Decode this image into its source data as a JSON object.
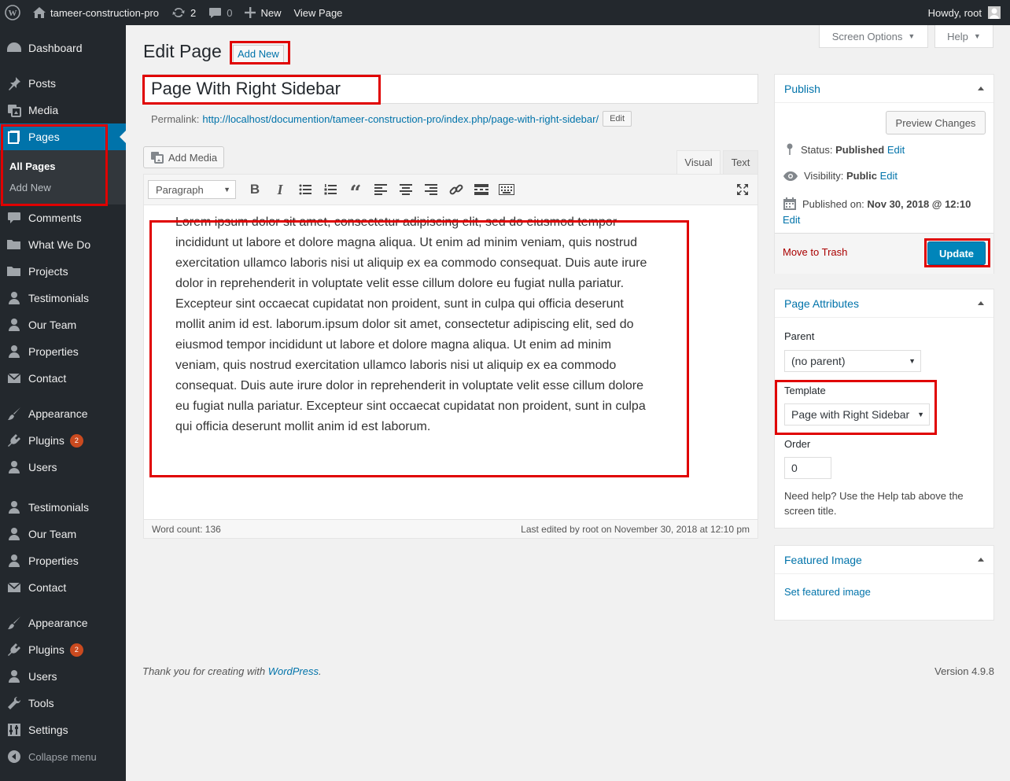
{
  "adminbar": {
    "site_name": "tameer-construction-pro",
    "updates_count": "2",
    "comments_count": "0",
    "new_label": "New",
    "view_page_label": "View Page",
    "howdy": "Howdy, root"
  },
  "sidebar": {
    "items": [
      {
        "label": "Dashboard"
      },
      {
        "label": "Posts"
      },
      {
        "label": "Media"
      },
      {
        "label": "Pages"
      },
      {
        "label": "Comments"
      },
      {
        "label": "What We Do"
      },
      {
        "label": "Projects"
      },
      {
        "label": "Testimonials"
      },
      {
        "label": "Our Team"
      },
      {
        "label": "Properties"
      },
      {
        "label": "Contact"
      },
      {
        "label": "Appearance"
      },
      {
        "label": "Plugins",
        "badge": "2"
      },
      {
        "label": "Users"
      },
      {
        "label": "Testimonials"
      },
      {
        "label": "Our Team"
      },
      {
        "label": "Properties"
      },
      {
        "label": "Contact"
      },
      {
        "label": "Appearance"
      },
      {
        "label": "Plugins",
        "badge": "2"
      },
      {
        "label": "Users"
      },
      {
        "label": "Tools"
      },
      {
        "label": "Settings"
      }
    ],
    "pages_submenu": [
      "All Pages",
      "Add New"
    ],
    "collapse_label": "Collapse menu"
  },
  "header": {
    "screen_options": "Screen Options",
    "help": "Help",
    "title": "Edit Page",
    "add_new": "Add New"
  },
  "post": {
    "title": "Page With Right Sidebar",
    "permalink_label": "Permalink:",
    "permalink_base": "http://localhost/documention/tameer-construction-pro/index.php/",
    "permalink_slug": "page-with-right-sidebar/",
    "edit_label": "Edit"
  },
  "editor": {
    "add_media": "Add Media",
    "tab_visual": "Visual",
    "tab_text": "Text",
    "format": "Paragraph",
    "content": "Lorem ipsum dolor sit amet, consectetur adipiscing elit, sed do eiusmod tempor incididunt ut labore et dolore magna aliqua. Ut enim ad minim veniam, quis nostrud exercitation ullamco laboris nisi ut aliquip ex ea commodo consequat. Duis aute irure dolor in reprehenderit in voluptate velit esse cillum dolore eu fugiat nulla pariatur. Excepteur sint occaecat cupidatat non proident, sunt in culpa qui officia deserunt mollit anim id est. laborum.ipsum dolor sit amet, consectetur adipiscing elit, sed do eiusmod tempor incididunt ut labore et dolore magna aliqua. Ut enim ad minim veniam, quis nostrud exercitation ullamco laboris nisi ut aliquip ex ea commodo consequat. Duis aute irure dolor in reprehenderit in voluptate velit esse cillum dolore eu fugiat nulla pariatur. Excepteur sint occaecat cupidatat non proident, sunt in culpa qui officia deserunt mollit anim id est laborum.",
    "word_count": "Word count: 136",
    "last_edited": "Last edited by root on November 30, 2018 at 12:10 pm"
  },
  "publish": {
    "title": "Publish",
    "preview": "Preview Changes",
    "status_label": "Status:",
    "status_value": "Published",
    "visibility_label": "Visibility:",
    "visibility_value": "Public",
    "published_label": "Published on:",
    "published_value": "Nov 30, 2018 @ 12:10",
    "edit": "Edit",
    "trash": "Move to Trash",
    "update": "Update"
  },
  "attributes": {
    "title": "Page Attributes",
    "parent_label": "Parent",
    "parent_value": "(no parent)",
    "template_label": "Template",
    "template_value": "Page with Right Sidebar",
    "order_label": "Order",
    "order_value": "0",
    "help_text": "Need help? Use the Help tab above the screen title."
  },
  "featured": {
    "title": "Featured Image",
    "set_link": "Set featured image"
  },
  "footer": {
    "thanks_prefix": "Thank you for creating with",
    "wordpress": "WordPress",
    "thanks_suffix": ".",
    "version": "Version 4.9.8"
  },
  "colors": {
    "highlight": "#e00000",
    "admin_dark": "#23282d",
    "accent": "#0073aa"
  }
}
